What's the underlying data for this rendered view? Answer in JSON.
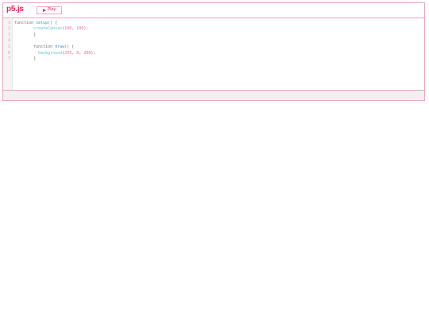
{
  "app": {
    "logo_text": "p5.js"
  },
  "toolbar": {
    "play_label": "Play",
    "play_icon": "play-icon"
  },
  "editor": {
    "line_numbers": [
      "1",
      "2",
      "3",
      "4",
      "5",
      "6",
      "7"
    ],
    "lines": [
      [
        {
          "t": "function ",
          "c": "keyword"
        },
        {
          "t": "setup",
          "c": "name"
        },
        {
          "t": "() {",
          "c": "plain"
        }
      ],
      [
        {
          "t": "        ",
          "c": "plain"
        },
        {
          "t": "createCanvas",
          "c": "builtin"
        },
        {
          "t": "(",
          "c": "plain"
        },
        {
          "t": "100",
          "c": "number"
        },
        {
          "t": ", ",
          "c": "plain"
        },
        {
          "t": "100",
          "c": "number"
        },
        {
          "t": ");",
          "c": "plain"
        }
      ],
      [
        {
          "t": "        }",
          "c": "plain"
        }
      ],
      [],
      [
        {
          "t": "        function ",
          "c": "keyword"
        },
        {
          "t": "draw",
          "c": "name"
        },
        {
          "t": "() {",
          "c": "plain"
        }
      ],
      [
        {
          "t": "          ",
          "c": "plain"
        },
        {
          "t": "background",
          "c": "builtin"
        },
        {
          "t": "(",
          "c": "plain"
        },
        {
          "t": "255",
          "c": "number"
        },
        {
          "t": ", ",
          "c": "plain"
        },
        {
          "t": "0",
          "c": "number"
        },
        {
          "t": ", ",
          "c": "plain"
        },
        {
          "t": "200",
          "c": "number"
        },
        {
          "t": ");",
          "c": "plain"
        }
      ],
      [
        {
          "t": "        }",
          "c": "plain"
        }
      ]
    ]
  },
  "colors": {
    "accent": "#ed225d",
    "border": "#e9a6c2",
    "console_bg": "#f0f0f0"
  }
}
